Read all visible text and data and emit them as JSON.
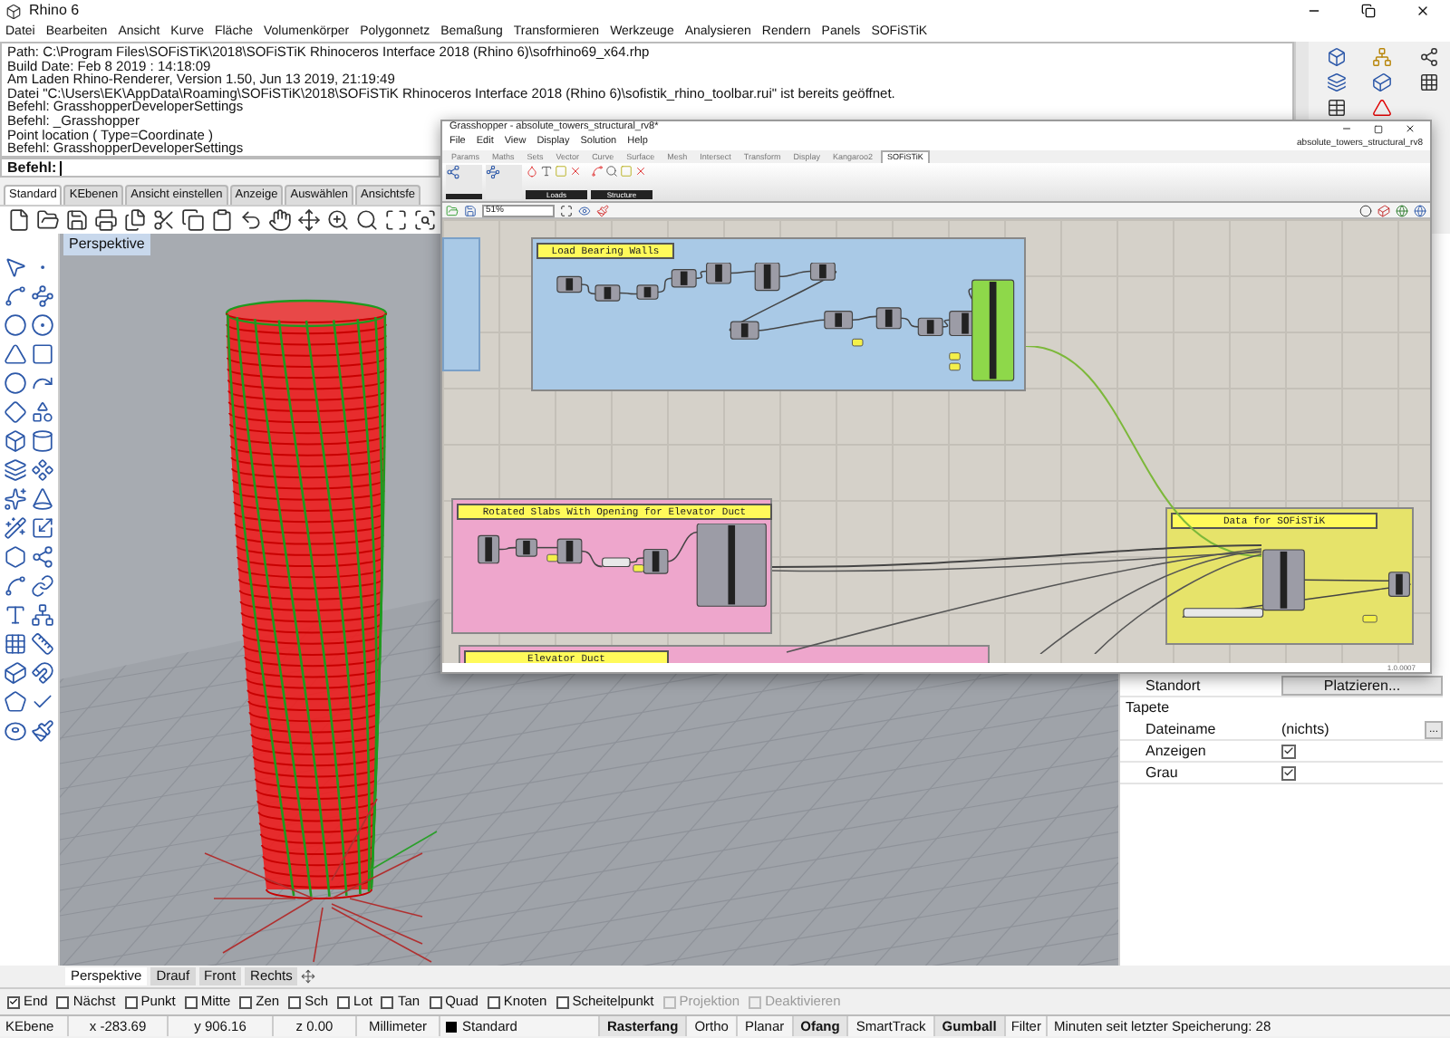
{
  "window": {
    "title": "Rhino 6"
  },
  "menu": [
    "Datei",
    "Bearbeiten",
    "Ansicht",
    "Kurve",
    "Fläche",
    "Volumenkörper",
    "Polygonnetz",
    "Bemaßung",
    "Transformieren",
    "Werkzeuge",
    "Analysieren",
    "Rendern",
    "Panels",
    "SOFiSTiK"
  ],
  "command_history": [
    "Path: C:\\Program Files\\SOFiSTiK\\2018\\SOFiSTiK Rhinoceros Interface 2018 (Rhino 6)\\sofrhino69_x64.rhp",
    "Build Date: Feb  8 2019 : 14:18:09",
    "Am Laden Rhino-Renderer, Version 1.50, Jun 13 2019, 21:19:49",
    "Datei \"C:\\Users\\EK\\AppData\\Roaming\\SOFiSTiK\\2018\\SOFiSTiK Rhinoceros Interface 2018 (Rhino 6)\\sofistik_rhino_toolbar.rui\" ist bereits geöffnet.",
    "Befehl: GrasshopperDeveloperSettings",
    "Befehl: _Grasshopper",
    "Point location ( Type=Coordinate )",
    "Befehl: GrasshopperDeveloperSettings"
  ],
  "command_prompt": {
    "label": "Befehl:"
  },
  "toolbar_tabs": [
    {
      "label": "Standard",
      "selected": true
    },
    {
      "label": "KEbenen",
      "selected": false
    },
    {
      "label": "Ansicht einstellen",
      "selected": false
    },
    {
      "label": "Anzeige",
      "selected": false
    },
    {
      "label": "Auswählen",
      "selected": false
    },
    {
      "label": "Ansichtsfe",
      "selected": false
    }
  ],
  "viewport": {
    "title": "Perspektive"
  },
  "viewport_tabs": [
    {
      "label": "Perspektive",
      "selected": true
    },
    {
      "label": "Drauf",
      "selected": false
    },
    {
      "label": "Front",
      "selected": false
    },
    {
      "label": "Rechts",
      "selected": false
    }
  ],
  "grasshopper": {
    "title": "Grasshopper - absolute_towers_structural_rv8*",
    "menu": [
      "File",
      "Edit",
      "View",
      "Display",
      "Solution",
      "Help"
    ],
    "document": "absolute_towers_structural_rv8",
    "tabs": [
      {
        "label": "Params",
        "selected": false
      },
      {
        "label": "Maths",
        "selected": false
      },
      {
        "label": "Sets",
        "selected": false
      },
      {
        "label": "Vector",
        "selected": false
      },
      {
        "label": "Curve",
        "selected": false
      },
      {
        "label": "Surface",
        "selected": false
      },
      {
        "label": "Mesh",
        "selected": false
      },
      {
        "label": "Intersect",
        "selected": false
      },
      {
        "label": "Transform",
        "selected": false
      },
      {
        "label": "Display",
        "selected": false
      },
      {
        "label": "Kangaroo2",
        "selected": false
      },
      {
        "label": "SOFiSTiK",
        "selected": true
      }
    ],
    "ribbon_groups": [
      "Loads",
      "Structure"
    ],
    "zoom": "51%",
    "groups": [
      {
        "label": "Load Bearing Walls",
        "color": "#a9c9e6"
      },
      {
        "label": "Rotated Slabs With Opening for Elevator Duct",
        "color": "#eea6cc"
      },
      {
        "label": "Elevator Duct",
        "color": "#eea6cc"
      },
      {
        "label": "Data for SOFiSTiK",
        "color": "#e6e36a"
      }
    ],
    "version": "1.0.0007"
  },
  "properties": {
    "rows": [
      {
        "kind": "button",
        "label": "Standort",
        "value": "Platzieren..."
      },
      {
        "kind": "heading",
        "label": "Tapete"
      },
      {
        "kind": "text",
        "label": "Dateiname",
        "value": "(nichts)",
        "button": "..."
      },
      {
        "kind": "check",
        "label": "Anzeigen",
        "checked": true
      },
      {
        "kind": "check",
        "label": "Grau",
        "checked": true
      }
    ]
  },
  "osnaps": [
    {
      "label": "End",
      "checked": true,
      "disabled": false
    },
    {
      "label": "Nächst",
      "checked": false,
      "disabled": false
    },
    {
      "label": "Punkt",
      "checked": false,
      "disabled": false
    },
    {
      "label": "Mitte",
      "checked": false,
      "disabled": false
    },
    {
      "label": "Zen",
      "checked": false,
      "disabled": false
    },
    {
      "label": "Sch",
      "checked": false,
      "disabled": false
    },
    {
      "label": "Lot",
      "checked": false,
      "disabled": false
    },
    {
      "label": "Tan",
      "checked": false,
      "disabled": false
    },
    {
      "label": "Quad",
      "checked": false,
      "disabled": false
    },
    {
      "label": "Knoten",
      "checked": false,
      "disabled": false
    },
    {
      "label": "Scheitelpunkt",
      "checked": false,
      "disabled": false
    },
    {
      "label": "Projektion",
      "checked": false,
      "disabled": true
    },
    {
      "label": "Deaktivieren",
      "checked": false,
      "disabled": true
    }
  ],
  "status_bar": {
    "layer": "KEbene",
    "x": "x -283.69",
    "y": "y 906.16",
    "z": "z 0.00",
    "units": "Millimeter",
    "current_layer": "Standard",
    "toggles": [
      {
        "label": "Rasterfang",
        "on": true
      },
      {
        "label": "Ortho",
        "on": false
      },
      {
        "label": "Planar",
        "on": false
      },
      {
        "label": "Ofang",
        "on": true
      },
      {
        "label": "SmartTrack",
        "on": false
      },
      {
        "label": "Gumball",
        "on": true
      }
    ],
    "filter": "Filter",
    "message": "Minuten seit letzter Speicherung: 28"
  }
}
